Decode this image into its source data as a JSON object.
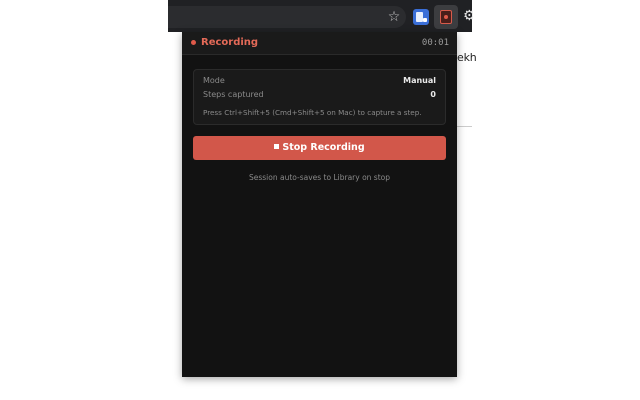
{
  "browser": {
    "page_fragment_text": "ekh",
    "icons": {
      "bookmark": "star-icon",
      "extension_1": "extension-icon",
      "extension_2": "recorder-extension-icon",
      "extensions_menu": "puzzle-icon"
    }
  },
  "popup": {
    "status_label": "Recording",
    "timer": "00:01",
    "accent_color": "#d2574a",
    "info": {
      "mode_label": "Mode",
      "mode_value": "Manual",
      "steps_label": "Steps captured",
      "steps_value": "0",
      "hint": "Press Ctrl+Shift+5 (Cmd+Shift+5 on Mac) to capture a step."
    },
    "stop_button_label": "Stop Recording",
    "footnote": "Session auto-saves to Library on stop"
  }
}
